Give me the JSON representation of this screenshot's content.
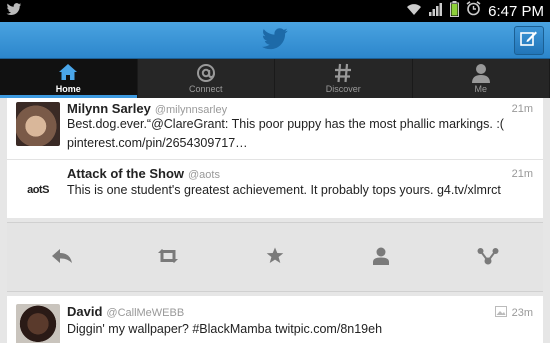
{
  "status_bar": {
    "time": "6:47 PM"
  },
  "tabs": [
    {
      "label": "Home",
      "icon": "home-icon",
      "active": true
    },
    {
      "label": "Connect",
      "icon": "at-icon"
    },
    {
      "label": "Discover",
      "icon": "hash-icon"
    },
    {
      "label": "Me",
      "icon": "person-icon"
    }
  ],
  "tweets": [
    {
      "name": "Milynn Sarley",
      "handle": "@milynnsarley",
      "time": "21m",
      "text": "Best.dog.ever.“@ClareGrant: This poor puppy has the most phallic markings. :(  pinterest.com/pin/2654309717…"
    },
    {
      "name": "Attack of the Show",
      "handle": "@aots",
      "time": "21m",
      "avatar_text": "aotS",
      "text": "This is one student's greatest achievement. It probably tops yours. g4.tv/xlmrct"
    },
    {
      "name": "David",
      "handle": "@CallMeWEBB",
      "time": "23m",
      "text": "Diggin' my wallpaper? #BlackMamba twitpic.com/8n19eh"
    }
  ],
  "tweet_actions": [
    "reply-icon",
    "retweet-icon",
    "favorite-icon",
    "profile-icon",
    "share-icon"
  ],
  "colors": {
    "accent": "#2c86cc",
    "tab_bg": "#262626"
  }
}
